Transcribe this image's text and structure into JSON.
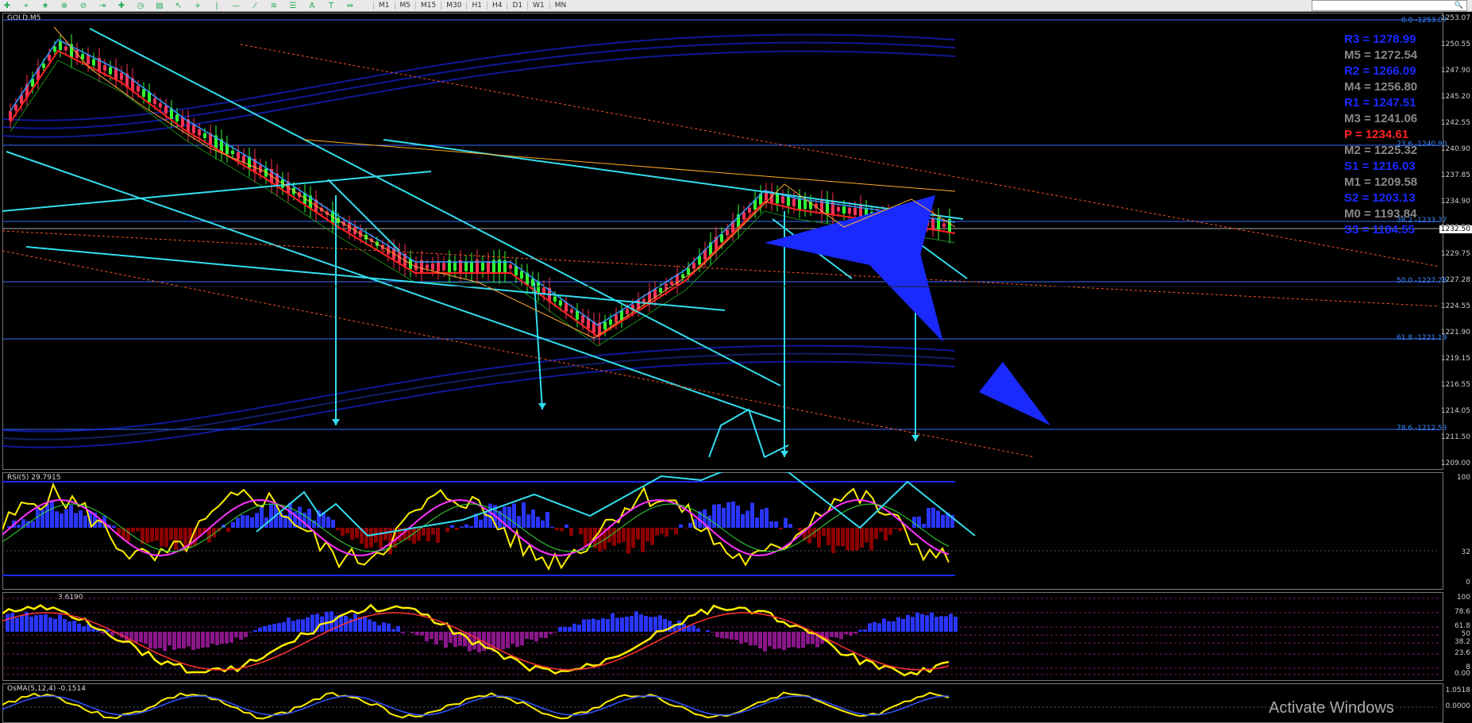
{
  "toolbar": {
    "timeframes": [
      "M1",
      "M5",
      "M15",
      "M30",
      "H1",
      "H4",
      "D1",
      "W1",
      "MN"
    ],
    "letter_tool": "A"
  },
  "main": {
    "symbol_label": "GOLD,M5",
    "price_axis": [
      "1253.07",
      "1250.55",
      "1247.90",
      "1245.20",
      "1242.55",
      "1240.90",
      "1237.85",
      "1234.90",
      "1232.50",
      "1229.75",
      "1227.28",
      "1224.55",
      "1221.90",
      "1219.15",
      "1216.55",
      "1214.05",
      "1211.50",
      "1209.00"
    ],
    "current_price": "1232.50",
    "pivots": [
      {
        "label": "R3 = 1278.99",
        "color": "#1a2aff"
      },
      {
        "label": "M5 = 1272.54",
        "color": "#888888"
      },
      {
        "label": "R2 = 1266.09",
        "color": "#1a2aff"
      },
      {
        "label": "M4 = 1256.80",
        "color": "#888888"
      },
      {
        "label": "R1 = 1247.51",
        "color": "#1a2aff"
      },
      {
        "label": "M3 = 1241.06",
        "color": "#888888"
      },
      {
        "label": "P  = 1234.61",
        "color": "#ff2020"
      },
      {
        "label": "M2 = 1225.32",
        "color": "#888888"
      },
      {
        "label": "S1 = 1216.03",
        "color": "#1a2aff"
      },
      {
        "label": "M1 = 1209.58",
        "color": "#888888"
      },
      {
        "label": "S2 = 1203.13",
        "color": "#1a2aff"
      },
      {
        "label": "M0 = 1193.84",
        "color": "#888888"
      },
      {
        "label": "S3 = 1184.55",
        "color": "#1a2aff"
      }
    ],
    "fib_levels": [
      {
        "label": "0.0 -1253.07"
      },
      {
        "label": "23.6 -1240.90"
      },
      {
        "label": "38.2 -1233.37"
      },
      {
        "label": "50.0 -1227.28"
      },
      {
        "label": "61.8 -1221.19"
      },
      {
        "label": "78.6 -1212.53"
      }
    ]
  },
  "rsi": {
    "label": "RSI(5) 29.7915",
    "axis": [
      "100",
      "32",
      "0"
    ]
  },
  "stoch": {
    "label": "3.6190",
    "axis": [
      "100",
      "78.6",
      "61.8",
      "50",
      "38.2",
      "23.6",
      "8",
      "0.00"
    ]
  },
  "osma": {
    "label": "OsMA(5,12,4) -0.1514",
    "axis": [
      "1.0518",
      "0.0000"
    ]
  },
  "watermark": "Activate Windows",
  "colors": {
    "bull": "#33ff33",
    "bear": "#ff3355",
    "cyan": "#33ddee",
    "blue": "#1a2aff",
    "yellow": "#ffee00",
    "magenta": "#ff33ff",
    "hist_up": "#2a36ff",
    "hist_dn": "#8b0000"
  }
}
